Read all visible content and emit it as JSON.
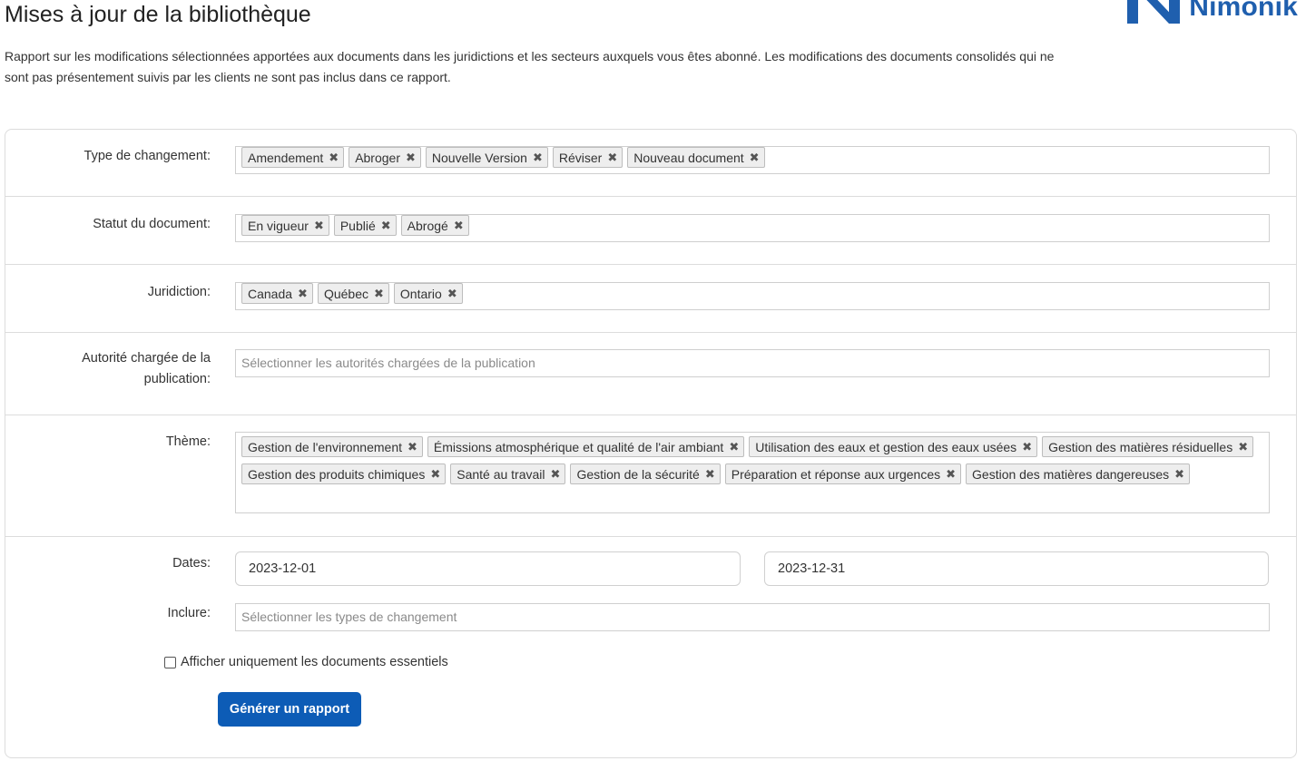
{
  "header": {
    "title": "Mises à jour de la bibliothèque",
    "logo_text": "Nimonik",
    "logo_color": "#1f5fae"
  },
  "intro_text": "Rapport sur les modifications sélectionnées apportées aux documents dans les juridictions et les secteurs auxquels vous êtes abonné. Les modifications des documents consolidés qui ne sont pas présentement suivis par les clients ne sont pas inclus dans ce rapport.",
  "form": {
    "change_type": {
      "label": "Type de changement:",
      "tags": [
        "Amendement",
        "Abroger",
        "Nouvelle Version",
        "Réviser",
        "Nouveau document"
      ]
    },
    "doc_status": {
      "label": "Statut du document:",
      "tags": [
        "En vigueur",
        "Publié",
        "Abrogé"
      ]
    },
    "jurisdiction": {
      "label": "Juridiction:",
      "tags": [
        "Canada",
        "Québec",
        "Ontario"
      ]
    },
    "authority": {
      "label_line1": "Autorité chargée de la",
      "label_line2": "publication:",
      "placeholder": "Sélectionner les autorités chargées de la publication"
    },
    "theme": {
      "label": "Thème:",
      "tags": [
        "Gestion de l'environnement",
        "Émissions atmosphérique et qualité de l'air ambiant",
        "Utilisation des eaux et gestion des eaux usées",
        "Gestion des matières résiduelles",
        "Gestion des produits chimiques",
        "Santé au travail",
        "Gestion de la sécurité",
        "Préparation et réponse aux urgences",
        "Gestion des matières dangereuses"
      ]
    },
    "dates": {
      "label": "Dates:",
      "start": "2023-12-01",
      "end": "2023-12-31"
    },
    "include": {
      "label": "Inclure:",
      "placeholder": "Sélectionner les types de changement"
    },
    "essential_only": {
      "label": "Afficher uniquement les documents essentiels",
      "checked": false
    },
    "submit_label": "Générer un rapport",
    "remove_glyph": "✖",
    "accent_color": "#0d5cb6"
  }
}
